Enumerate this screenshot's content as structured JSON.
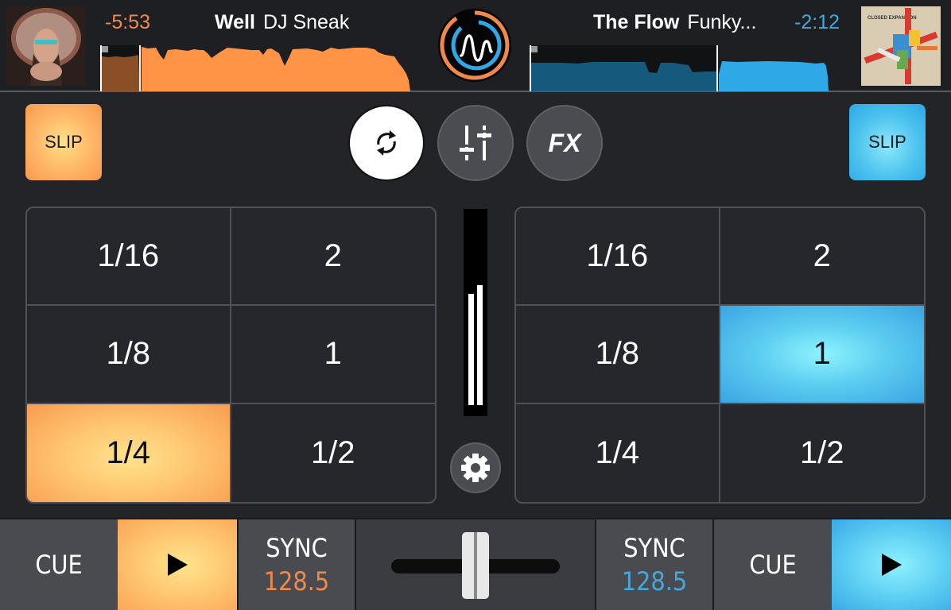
{
  "deck_left": {
    "album_art": "album-art-headdress",
    "remaining_time": "-5:53",
    "track_title": "Well",
    "artist": "DJ Sneak",
    "waveform_color": "#ff9447",
    "waveform_played_color": "#8a4f26",
    "playhead_position": 0.12,
    "slip_label": "SLIP",
    "pads": [
      "1/16",
      "2",
      "1/8",
      "1",
      "1/4",
      "1/2"
    ],
    "active_pad": "1/4",
    "cue_label": "CUE",
    "sync_label": "SYNC",
    "bpm": "128.5",
    "accent": "#f08a4b"
  },
  "deck_right": {
    "album_art": "album-art-closed-expansion",
    "album_art_text": "CLOSED EXPANSION",
    "remaining_time": "-2:12",
    "track_title": "The Flow",
    "artist": "Funky...",
    "waveform_color": "#2ea8e6",
    "waveform_played_color": "#155a7c",
    "playhead_position": 0.59,
    "slip_label": "SLIP",
    "pads": [
      "1/16",
      "2",
      "1/8",
      "1",
      "1/4",
      "1/2"
    ],
    "active_pad": "1",
    "cue_label": "CUE",
    "sync_label": "SYNC",
    "bpm": "128.5",
    "accent": "#45a8dc"
  },
  "center": {
    "logo": "app-logo-wave",
    "buttons": [
      {
        "name": "loop",
        "icon": "sync-loop-icon",
        "active": true
      },
      {
        "name": "mixer",
        "icon": "sliders-icon",
        "active": false
      },
      {
        "name": "fx",
        "label": "FX",
        "active": false
      }
    ],
    "meter_levels": [
      0.6,
      0.65
    ],
    "settings_icon": "gear-icon",
    "crossfader_position": 0.5
  }
}
